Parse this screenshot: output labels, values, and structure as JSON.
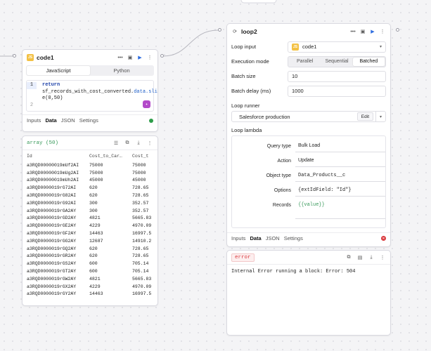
{
  "code_node": {
    "title": "code1",
    "icon": "js-icon",
    "languages": [
      "JavaScript",
      "Python"
    ],
    "active_language": "JavaScript",
    "code_lines": [
      "return",
      "sf_records_with_cost_converted.",
      "data.slic",
      "e(0,50)"
    ],
    "line_numbers": [
      "1",
      "2"
    ],
    "tabs": [
      "Inputs",
      "Data",
      "JSON",
      "Settings"
    ],
    "active_tab": "Data"
  },
  "data_panel": {
    "type_label": "array (50)",
    "columns": [
      "Id",
      "Cost_to_Car…",
      "Cost_t"
    ],
    "rows": [
      [
        "a3RQD00000019mUf2AI",
        "75000",
        "75000"
      ],
      [
        "a3RQD00000019mUg2AI",
        "75000",
        "75000"
      ],
      [
        "a3RQD00000019mUh2AI",
        "45000",
        "45000"
      ],
      [
        "a3RQD0000019rG72AI",
        "620",
        "728.65"
      ],
      [
        "a3RQD0000019rG82AI",
        "620",
        "728.65"
      ],
      [
        "a3RQD0000019rG92AI",
        "300",
        "352.57"
      ],
      [
        "a3RQD0000019rGA2AY",
        "300",
        "352.57"
      ],
      [
        "a3RQD0000019rGD2AY",
        "4821",
        "5665.83"
      ],
      [
        "a3RQD0000019rGE2AY",
        "4229",
        "4970.09"
      ],
      [
        "a3RQD0000019rGF2AY",
        "14463",
        "16997.5"
      ],
      [
        "a3RQD0000019rGG2AY",
        "12687",
        "14910.2"
      ],
      [
        "a3RQD0000019rGQ2AY",
        "620",
        "728.65"
      ],
      [
        "a3RQD0000019rGR2AY",
        "620",
        "728.65"
      ],
      [
        "a3RQD0000019rGS2AY",
        "600",
        "705.14"
      ],
      [
        "a3RQD0000019rGT2AY",
        "600",
        "705.14"
      ],
      [
        "a3RQD0000019rGW2AY",
        "4821",
        "5665.83"
      ],
      [
        "a3RQD0000019rGX2AY",
        "4229",
        "4970.09"
      ],
      [
        "a3RQD0000019rGY2AY",
        "14463",
        "16997.5"
      ]
    ]
  },
  "loop_node": {
    "title": "loop2",
    "icon": "loop-icon",
    "fields": {
      "loop_input_label": "Loop input",
      "loop_input_value": "code1",
      "execution_mode_label": "Execution mode",
      "execution_modes": [
        "Parallel",
        "Sequential",
        "Batched"
      ],
      "active_mode": "Batched",
      "batch_size_label": "Batch size",
      "batch_size_value": "10",
      "batch_delay_label": "Batch delay (ms)",
      "batch_delay_value": "1000",
      "loop_runner_label": "Loop runner",
      "loop_runner_value": "Salesforce production",
      "edit_label": "Edit",
      "loop_lambda_label": "Loop lambda"
    },
    "lambda": {
      "query_type_label": "Query type",
      "query_type_value": "Bulk Load",
      "action_label": "Action",
      "action_value": "Update",
      "object_type_label": "Object type",
      "object_type_value": "Data_Products__c",
      "options_label": "Options",
      "options_value": "{extIdField: \"Id\"}",
      "records_label": "Records",
      "records_value": "{{value}}"
    },
    "tabs": [
      "Inputs",
      "Data",
      "JSON",
      "Settings"
    ],
    "active_tab": "Data"
  },
  "error_panel": {
    "tag": "error",
    "message": "Internal Error running a block: Error: 504"
  },
  "colors": {
    "accent": "#2d6cdf",
    "success": "#2e9d4a",
    "error": "#d9383c",
    "js_badge": "#f3c144",
    "ai_button": "#b34ac9"
  }
}
